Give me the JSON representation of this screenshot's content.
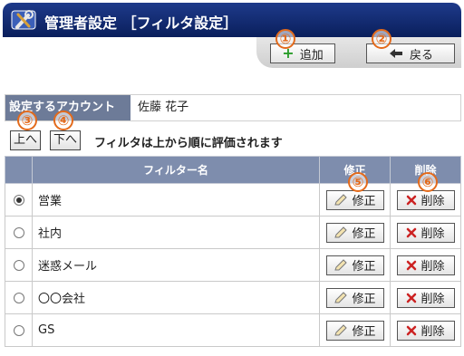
{
  "header": {
    "title": "管理者設定 ［フィルタ設定］",
    "icon": "tools-icon"
  },
  "toolbar": {
    "add_label": "追加",
    "back_label": "戻る"
  },
  "annotations": [
    "①",
    "②",
    "③",
    "④",
    "⑤",
    "⑥"
  ],
  "account": {
    "label": "設定するアカウント",
    "value": "佐藤 花子"
  },
  "order": {
    "up_label": "上へ",
    "down_label": "下へ",
    "hint": "フィルタは上から順に評価されます"
  },
  "table": {
    "headers": {
      "select": "",
      "name": "フィルター名",
      "edit": "修正",
      "delete": "削除"
    },
    "edit_label": "修正",
    "delete_label": "削除",
    "rows": [
      {
        "name": "営業",
        "selected": true
      },
      {
        "name": "社内",
        "selected": false
      },
      {
        "name": "迷惑メール",
        "selected": false
      },
      {
        "name": "〇〇会社",
        "selected": false
      },
      {
        "name": "GS",
        "selected": false
      }
    ]
  },
  "colors": {
    "title_bg": "#0a1f5c",
    "header_bg": "#7e8dad",
    "annotation": "#e36a1b",
    "delete_x": "#cc2222",
    "add_plus": "#2a9d2a"
  }
}
